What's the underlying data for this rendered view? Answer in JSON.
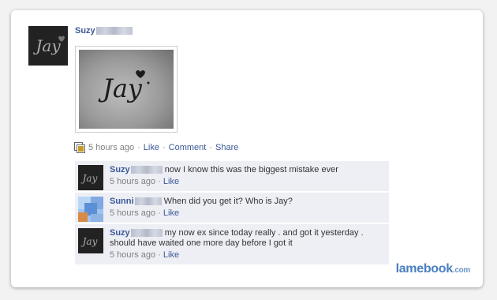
{
  "post": {
    "author": "Suzy",
    "timestamp": "5 hours ago",
    "actions": {
      "like": "Like",
      "comment": "Comment",
      "share": "Share"
    },
    "photo_text": "Jay"
  },
  "comments": [
    {
      "name": "Suzy",
      "text": "now I know this was the biggest mistake ever",
      "time": "5 hours ago",
      "like": "Like",
      "avatar": "tattoo"
    },
    {
      "name": "Sunni",
      "text": "When did you get it? Who is Jay?",
      "time": "5 hours ago",
      "like": "Like",
      "avatar": "pixelated"
    },
    {
      "name": "Suzy",
      "text": "my now ex since today really . and got it yesterday . should have waited one more day before I got it",
      "time": "5 hours ago",
      "like": "Like",
      "avatar": "tattoo"
    }
  ],
  "watermark": {
    "brand": "lamebook",
    "suffix": ".com"
  },
  "colors": {
    "link": "#3b5998",
    "comment_bg": "#edeff4",
    "meta": "#808080",
    "watermark": "#4a7fbf"
  }
}
